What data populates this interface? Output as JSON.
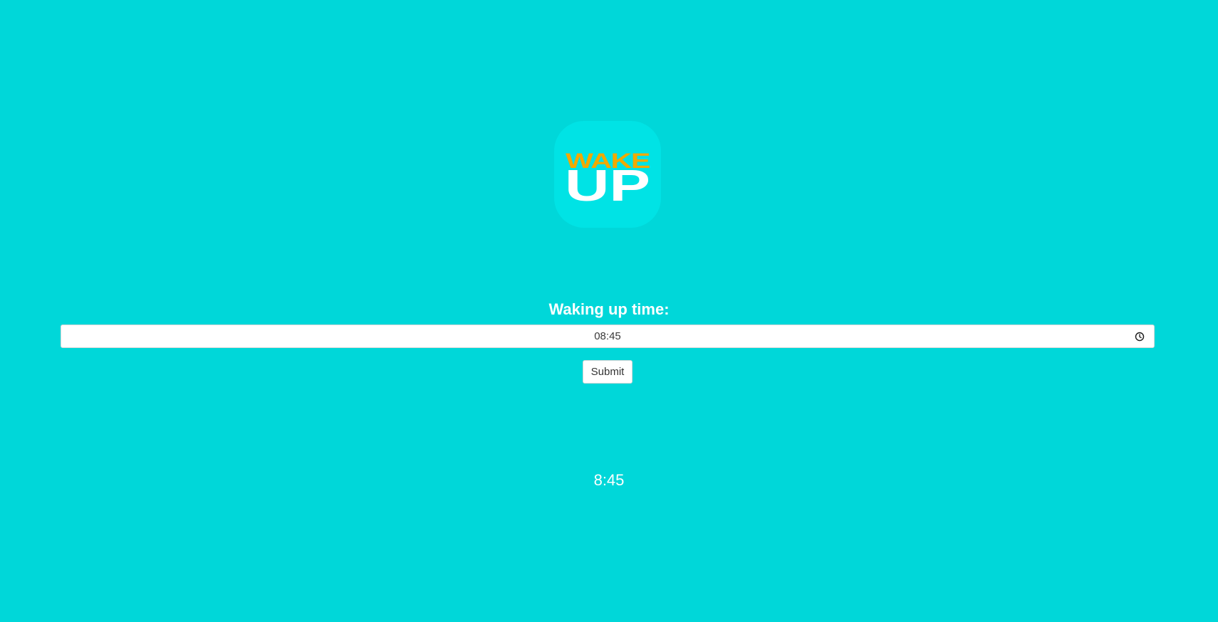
{
  "logo": {
    "line1": "WAKE",
    "line2": "UP",
    "line1_color": "#f2a900",
    "line2_color": "#ffffff"
  },
  "form": {
    "label": "Waking up time:",
    "time_value": "08:45",
    "submit_label": "Submit",
    "clock_icon": "clock-icon"
  },
  "result": {
    "time": "8:45"
  },
  "colors": {
    "background": "#00d7d9",
    "logo_tile": "#00e3e5"
  }
}
